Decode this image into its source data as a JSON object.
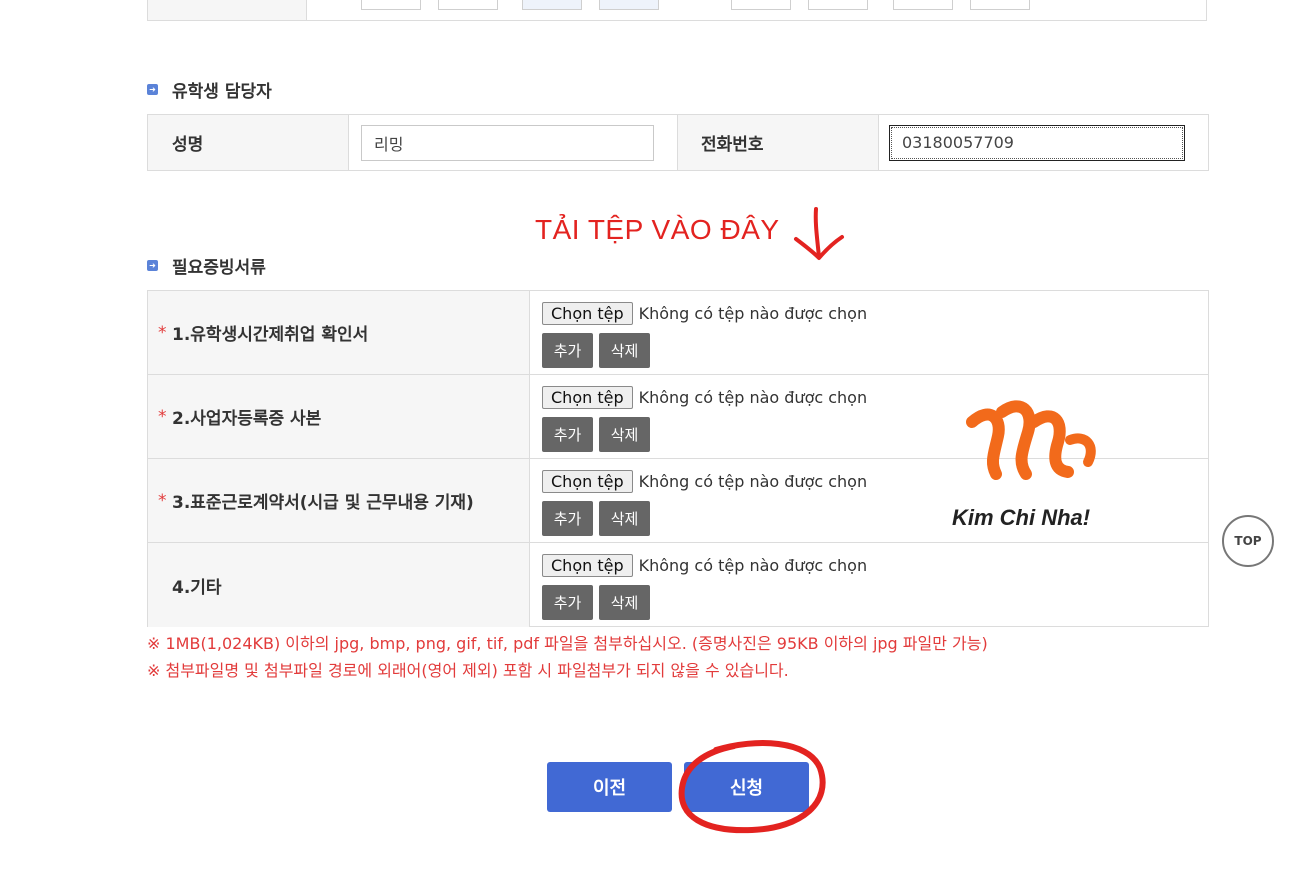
{
  "contact_section": {
    "title": "유학생 담당자",
    "name_label": "성명",
    "name_value": "리밍",
    "phone_label": "전화번호",
    "phone_value": "03180057709"
  },
  "annotation_text": "TẢI TỆP VÀO ĐÂY",
  "docs_section": {
    "title": "필요증빙서류",
    "rows": [
      {
        "required": "*",
        "label": "1.유학생시간제취업 확인서"
      },
      {
        "required": "*",
        "label": "2.사업자등록증 사본"
      },
      {
        "required": "*",
        "label": "3.표준근로계약서(시급 및 근무내용 기재)"
      },
      {
        "required": "",
        "label": "4.기타"
      }
    ],
    "choose_file_label": "Chọn tệp",
    "no_file_text": "Không có tệp nào được chọn",
    "add_label": "추가",
    "delete_label": "삭제"
  },
  "notes": [
    "※ 1MB(1,024KB) 이하의 jpg, bmp, png, gif, tif, pdf 파일을 첨부하십시오. (증명사진은 95KB 이하의 jpg 파일만 가능)",
    "※ 첨부파일명 및 첨부파일 경로에 외래어(영어 제외) 포함 시 파일첨부가 되지 않을 수 있습니다."
  ],
  "logo_text": "Kim Chi Nha!",
  "top_button_label": "TOP",
  "prev_button_label": "이전",
  "submit_button_label": "신청",
  "colors": {
    "primary_button": "#4169d4",
    "annotation_red": "#e32320",
    "note_red": "#e23b3b",
    "logo_orange": "#f26a1b",
    "dark_button": "#666666"
  },
  "icons": [
    "section-bullet-icon",
    "arrow-down-icon",
    "kim-chi-nha-logo-icon"
  ]
}
